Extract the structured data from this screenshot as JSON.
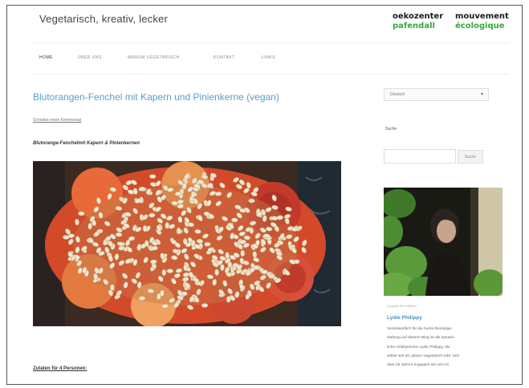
{
  "header": {
    "site_title": "Vegetarisch, kreativ, lecker",
    "logo": {
      "left_top": "oekozenter",
      "left_bottom": "pafendall",
      "right_top": "mouvement",
      "right_bottom": "écologique"
    }
  },
  "nav": {
    "items": [
      "HOME",
      "ÜBER UNS",
      "WARUM VEGETARISCH",
      "KONTAKT",
      "LINKS"
    ]
  },
  "post": {
    "title": "Blutorangen-Fenchel mit Kapern und Pinienkerne (vegan)",
    "comment_link": "Schreibe einen Kommentar",
    "caption": "Blutorange-Fenchelmit Kapern & Pinienkernen",
    "ingredients_heading": "Zutaten für 4 Personen:"
  },
  "sidebar": {
    "language_select": "Deutsch",
    "search_heading": "Suche",
    "search_placeholder": "",
    "search_button": "Suche",
    "image_caption": "Copyright Rita Raffhiller",
    "author_name": "Lydie Philippy",
    "bio_lines": [
      "Verantwortlich für die bunte Rezeptge-",
      "staltung auf diesem Blog ist die dynami-",
      "sche Hobbyköchin Lydie Philippy, die",
      "selbst seit 30 Jahren vegetarisch lebt. Seit",
      "über 25 Jahren engagiert sie sich im"
    ]
  },
  "colors": {
    "link": "#5aa0c8",
    "author": "#4a90bf",
    "logo_green": "#3aa83a"
  }
}
